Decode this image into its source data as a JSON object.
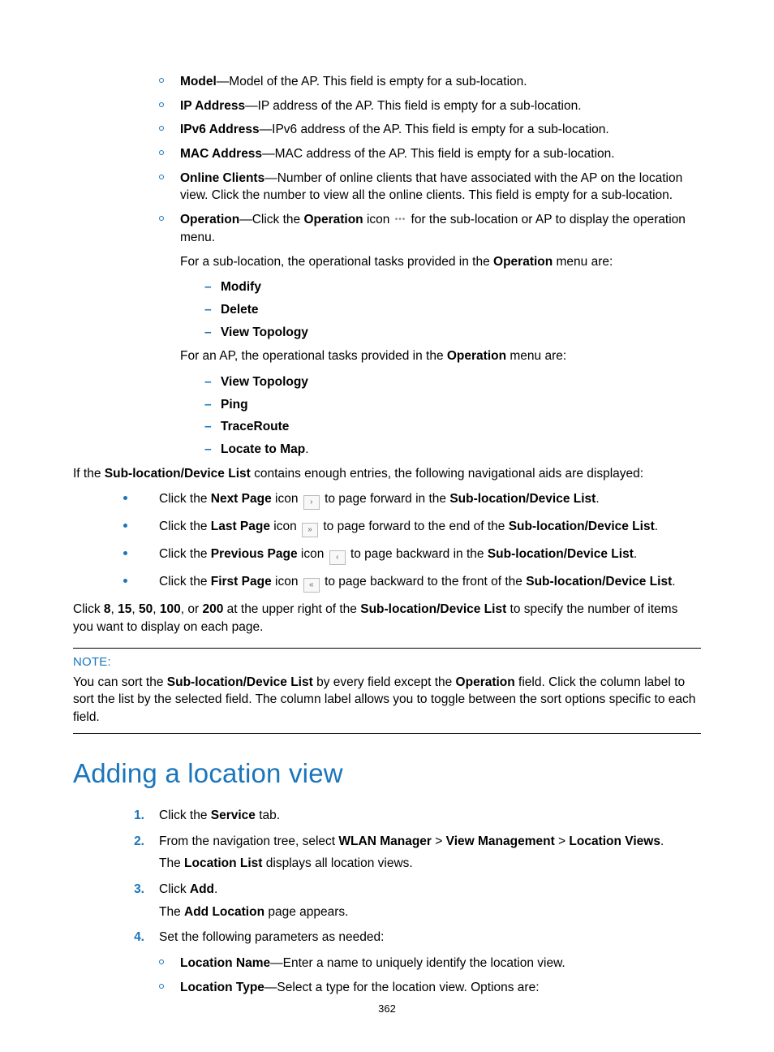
{
  "fields": {
    "model": {
      "term": "Model",
      "desc": "—Model of the AP. This field is empty for a sub-location."
    },
    "ip": {
      "term": "IP Address",
      "desc": "—IP address of the AP. This field is empty for a sub-location."
    },
    "ipv6": {
      "term": "IPv6 Address",
      "desc": "—IPv6 address of the AP. This field is empty for a sub-location."
    },
    "mac": {
      "term": "MAC Address",
      "desc": "—MAC address of the AP. This field is empty for a sub-location."
    },
    "clients": {
      "term": "Online Clients",
      "desc": "—Number of online clients that have associated with the AP on the location view. Click the number to view all the online clients. This field is empty for a sub-location."
    },
    "operation": {
      "term": "Operation",
      "pre": "—Click the ",
      "iconword": "Operation",
      "iconpost": " icon ",
      "post": " for the sub-location or AP to display the operation menu."
    },
    "op_subloc_intro_a": "For a sub-location, the operational tasks provided in the ",
    "op_menu_word": "Operation",
    "op_subloc_intro_b": " menu are:",
    "subloc_tasks": {
      "modify": "Modify",
      "delete": "Delete",
      "viewtopo": "View Topology"
    },
    "op_ap_intro_a": "For an AP, the operational tasks provided in the ",
    "op_ap_intro_b": " menu are:",
    "ap_tasks": {
      "viewtopo": "View Topology",
      "ping": "Ping",
      "trace": "TraceRoute",
      "locate": "Locate to Map"
    },
    "ap_tasks_period": "."
  },
  "nav_intro_a": "If the ",
  "nav_intro_b": "Sub-location/Device List",
  "nav_intro_c": " contains enough entries, the following navigational aids are displayed:",
  "nav": {
    "next": {
      "a": "Click the ",
      "b": "Next Page",
      "c": " icon ",
      "d": " to page forward in the ",
      "e": "Sub-location/Device List",
      "f": "."
    },
    "last": {
      "a": "Click the ",
      "b": "Last Page",
      "c": " icon ",
      "d": " to page forward to the end of the ",
      "e": "Sub-location/Device List",
      "f": "."
    },
    "prev": {
      "a": "Click the ",
      "b": "Previous Page",
      "c": " icon ",
      "d": " to page backward in the ",
      "e": "Sub-location/Device List",
      "f": "."
    },
    "first": {
      "a": "Click the ",
      "b": "First Page",
      "c": " icon ",
      "d": " to page backward to the front of the ",
      "e": "Sub-location/Device List",
      "f": "."
    }
  },
  "pager_a": "Click ",
  "pager_n1": "8",
  "pager_s1": ", ",
  "pager_n2": "15",
  "pager_s2": ", ",
  "pager_n3": "50",
  "pager_s3": ", ",
  "pager_n4": "100",
  "pager_s4": ", or ",
  "pager_n5": "200",
  "pager_b": " at the upper right of the ",
  "pager_c": "Sub-location/Device List",
  "pager_d": " to specify the number of items you want to display on each page.",
  "note": {
    "label": "NOTE:",
    "a": "You can sort the ",
    "b": "Sub-location/Device List",
    "c": " by every field except the ",
    "d": "Operation",
    "e": " field. Click the column label to sort the list by the selected field. The column label allows you to toggle between the sort options specific to each field."
  },
  "section_title": "Adding a location view",
  "steps": {
    "s1": {
      "num": "1.",
      "a": "Click the ",
      "b": "Service",
      "c": " tab."
    },
    "s2": {
      "num": "2.",
      "a": "From the navigation tree, select ",
      "p1": "WLAN Manager",
      "sep1": " > ",
      "p2": "View Management",
      "sep2": " > ",
      "p3": "Location Views",
      "end": ".",
      "sub_a": "The ",
      "sub_b": "Location List",
      "sub_c": " displays all location views."
    },
    "s3": {
      "num": "3.",
      "a": "Click ",
      "b": "Add",
      "c": ".",
      "sub_a": "The ",
      "sub_b": "Add Location",
      "sub_c": " page appears."
    },
    "s4": {
      "num": "4.",
      "a": "Set the following parameters as needed:",
      "p_name": {
        "term": "Location Name",
        "desc": "—Enter a name to uniquely identify the location view."
      },
      "p_type": {
        "term": "Location Type",
        "desc": "—Select a type for the location view. Options are:"
      }
    }
  },
  "page_number": "362"
}
